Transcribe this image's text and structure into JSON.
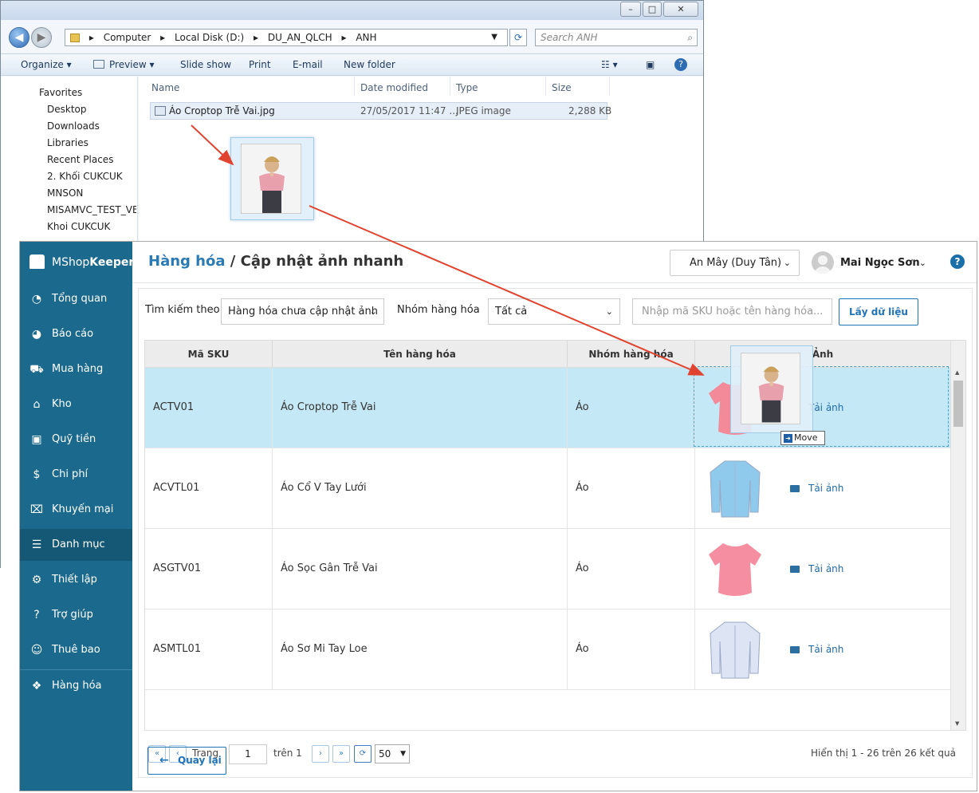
{
  "explorer": {
    "breadcrumb": [
      "Computer",
      "Local Disk (D:)",
      "DU_AN_QLCH",
      "ANH"
    ],
    "search_placeholder": "Search ANH",
    "toolbar": {
      "organize": "Organize ▾",
      "preview": "Preview ▾",
      "slideshow": "Slide show",
      "print": "Print",
      "email": "E-mail",
      "newfolder": "New folder"
    },
    "nav": [
      "Favorites",
      "Desktop",
      "Downloads",
      "Libraries",
      "Recent Places",
      "2. Khối CUKCUK",
      "MNSON",
      "MISAMVC_TEST_VER",
      "Khoi CUKCUK"
    ],
    "columns": {
      "name": "Name",
      "date": "Date modified",
      "type": "Type",
      "size": "Size"
    },
    "file": {
      "name": "Áo Croptop Trễ Vai.jpg",
      "date": "27/05/2017 11:47 ...",
      "type": "JPEG image",
      "size": "2,288 KB"
    }
  },
  "app": {
    "logo_light": "MShop",
    "logo_bold": "Keeper",
    "sidebar": [
      "Tổng quan",
      "Báo cáo",
      "Mua hàng",
      "Kho",
      "Quỹ tiền",
      "Chi phí",
      "Khuyến mại",
      "Danh mục",
      "Thiết lập",
      "Trợ giúp",
      "Thuê bao",
      "Hàng hóa"
    ],
    "sidebar_active": "Danh mục",
    "breadcrumb_link": "Hàng hóa",
    "breadcrumb_sep": " / ",
    "page_title": "Cập nhật ảnh nhanh",
    "store": "An Mây (Duy Tân)",
    "user": "Mai Ngọc Sơn",
    "filter": {
      "search_by_label": "Tìm kiếm theo",
      "search_by_value": "Hàng hóa chưa cập nhật ảnh",
      "group_label": "Nhóm hàng hóa",
      "group_value": "Tất cả",
      "sku_placeholder": "Nhập mã SKU hoặc tên hàng hóa...",
      "fetch_button": "Lấy dữ liệu"
    },
    "grid": {
      "headers": [
        "Mã SKU",
        "Tên hàng hóa",
        "Nhóm hàng hóa",
        "Ảnh"
      ],
      "upload_label": "Tải ảnh",
      "rows": [
        {
          "sku": "ACTV01",
          "name": "Áo Croptop Trễ Vai",
          "group": "Áo",
          "shirt_color": "#f28a99"
        },
        {
          "sku": "ACVTL01",
          "name": "Áo Cổ V Tay Lưới",
          "group": "Áo",
          "shirt_color": "#8fc9ec"
        },
        {
          "sku": "ASGTV01",
          "name": "Áo Sọc Gân Trễ Vai",
          "group": "Áo",
          "shirt_color": "#f58ea1"
        },
        {
          "sku": "ASMTL01",
          "name": "Áo Sơ Mi Tay Loe",
          "group": "Áo",
          "shirt_color": "#dde4f4"
        }
      ]
    },
    "pager": {
      "page_label": "Trang",
      "page": "1",
      "of_label": "trên 1",
      "page_size": "50",
      "summary": "Hiển thị 1 - 26 trên 26 kết quả"
    },
    "back_button": "Quay lại",
    "drag_tooltip": "Move"
  },
  "colors": {
    "sidebar": "#1b6a8e",
    "accent": "#1f73b7",
    "selected_row": "#c5e8f6",
    "arrow": "#e0432f"
  }
}
